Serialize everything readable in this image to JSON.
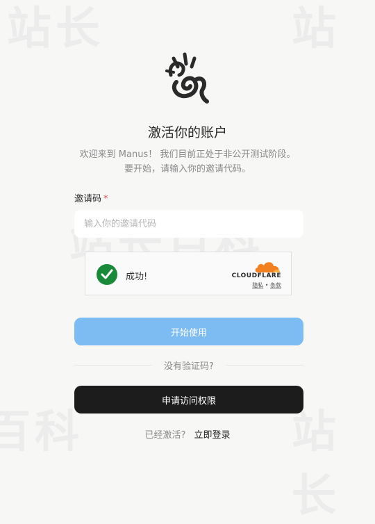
{
  "heading": {
    "title": "激活你的账户",
    "subtitle_line1": "欢迎来到 Manus！ 我们目前正处于非公开测试阶段。",
    "subtitle_line2": "要开始，请输入你的邀请代码。"
  },
  "form": {
    "invite_label": "邀请码",
    "required_mark": "*",
    "invite_placeholder": "输入你的邀请代码",
    "invite_value": ""
  },
  "captcha": {
    "status_text": "成功!",
    "provider": "CLOUDFLARE",
    "privacy_link": "隐私",
    "separator": "•",
    "terms_link": "条款",
    "success_color": "#1a8a3a",
    "brand_color": "#f38020"
  },
  "actions": {
    "start_button": "开始使用",
    "no_code_text": "没有验证码?",
    "apply_button": "申请访问权限",
    "activated_text": "已经激活?",
    "login_link": "立即登录"
  },
  "colors": {
    "primary_button": "#7dbcf2",
    "dark_button": "#1c1c1c",
    "background": "#f7f7f6"
  },
  "icons": {
    "logo": "manus-hand-logo",
    "check": "check-circle-icon",
    "cloud": "cloudflare-cloud-icon"
  }
}
